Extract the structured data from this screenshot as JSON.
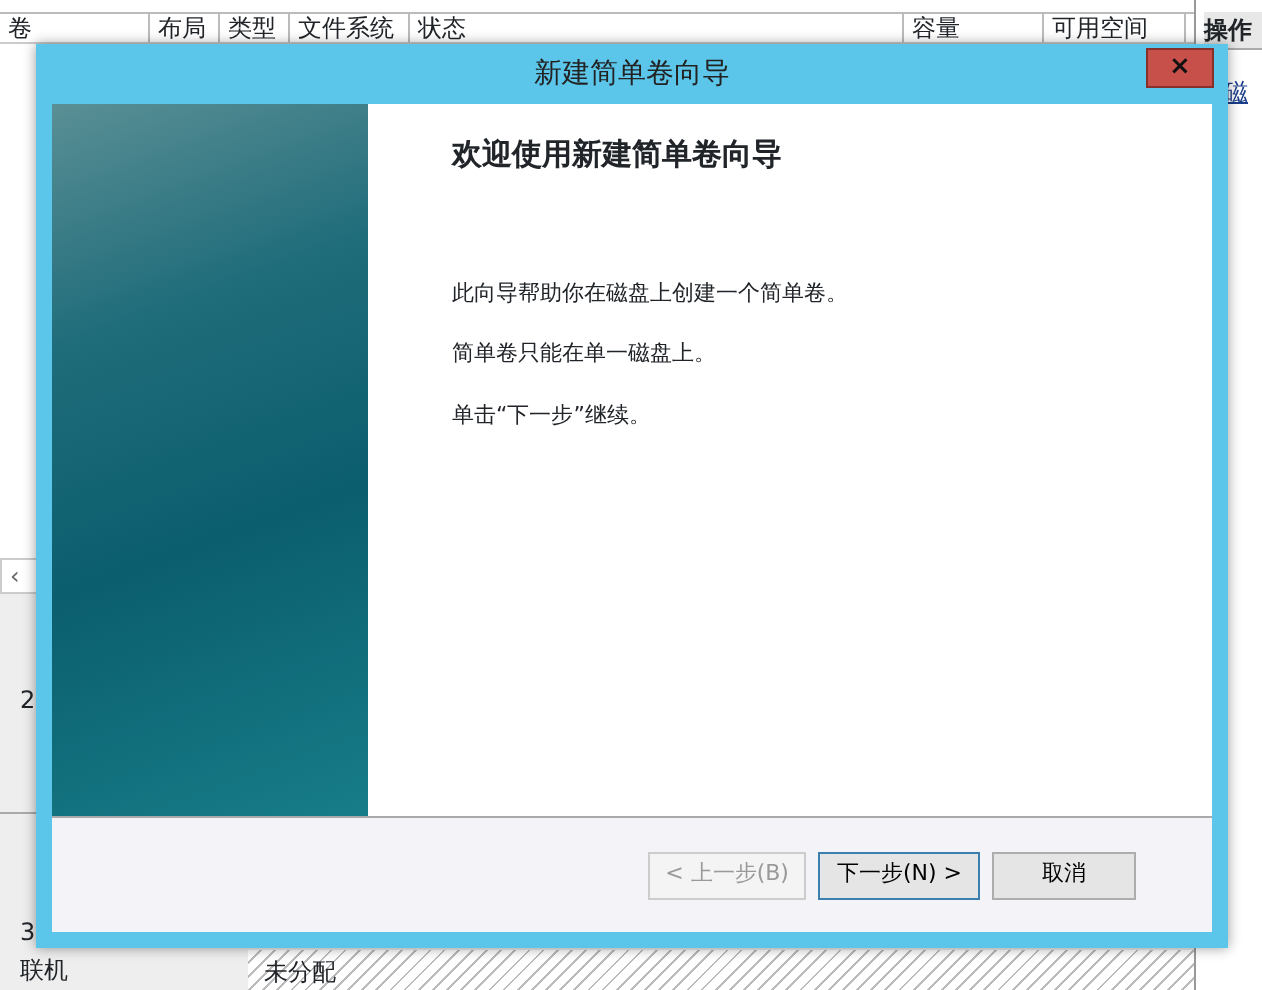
{
  "background": {
    "columns": [
      "卷",
      "布局",
      "类型",
      "文件系统",
      "状态",
      "容量",
      "可用空间"
    ],
    "scroll_arrow": "‹",
    "actions_header": "操作",
    "actions_item": "磁",
    "disks": [
      {
        "lines": [
          "2"
        ]
      },
      {
        "lines": [
          "3",
          "联机"
        ]
      }
    ],
    "partition_label": "未分配"
  },
  "dialog": {
    "title": "新建简单卷向导",
    "close": "×",
    "heading": "欢迎使用新建简单卷向导",
    "paragraphs": [
      "此向导帮助你在磁盘上创建一个简单卷。",
      "简单卷只能在单一磁盘上。",
      "单击“下一步”继续。"
    ],
    "buttons": [
      {
        "label": "< 上一步(B)",
        "disabled": true
      },
      {
        "label": "下一步(N) >",
        "disabled": false
      },
      {
        "label": "取消",
        "disabled": false
      }
    ]
  }
}
